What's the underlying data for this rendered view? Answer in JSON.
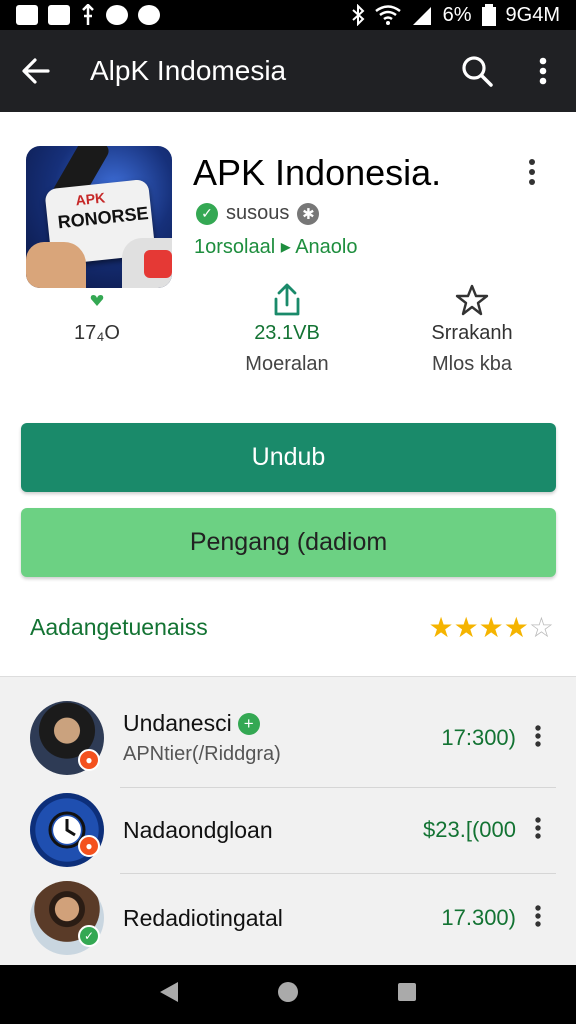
{
  "status_bar": {
    "battery": "6%",
    "time": "9G4M",
    "icons": [
      "photo-icon",
      "image-icon",
      "usb-icon",
      "game-icon",
      "smile-icon",
      "bluetooth-icon",
      "wifi-icon",
      "signal-icon",
      "battery-icon"
    ]
  },
  "app_bar": {
    "title": "AlpK Indomesia",
    "back_icon": "arrow-left-icon",
    "search_icon": "search-icon",
    "more_icon": "more-vert-icon"
  },
  "app": {
    "name": "APK Indonesia.",
    "icon_text_top": "APK",
    "icon_text": "RONORSE",
    "developer": "susous",
    "category": "1orsolaal ▸ Anaolo"
  },
  "stats": [
    {
      "value": "17₄O",
      "label": "",
      "icon": "heart-icon"
    },
    {
      "value": "23.1VB",
      "label": "Moeralan",
      "icon": "share-icon"
    },
    {
      "value": "Srrakanh",
      "label": "Mlos kba",
      "icon": "star-outline-icon"
    }
  ],
  "buttons": {
    "primary": "Undub",
    "secondary": "Pengang (dadiom"
  },
  "rating": {
    "label": "Aadangetuenaiss",
    "value": 4,
    "max": 5
  },
  "list": [
    {
      "name": "Undanesci",
      "sub": "APNtier(/Riddgra)",
      "price": "17:300)",
      "verified": true,
      "avatar_color": "#3a2a22",
      "badge_color": "#f4511e"
    },
    {
      "name": "Nadaondgloan",
      "sub": "",
      "price": "$23.[(000",
      "verified": false,
      "avatar_color": "#1f4fb0",
      "badge_color": "#f4511e"
    },
    {
      "name": "Redadiotingatal",
      "sub": "",
      "price": "17.300)",
      "verified": false,
      "avatar_color": "#6b4b35",
      "badge_color": "#34a853"
    }
  ],
  "colors": {
    "primary_button": "#1a8a6a",
    "secondary_button": "#6cd183",
    "accent_green": "#137333",
    "app_bar": "#202124"
  }
}
